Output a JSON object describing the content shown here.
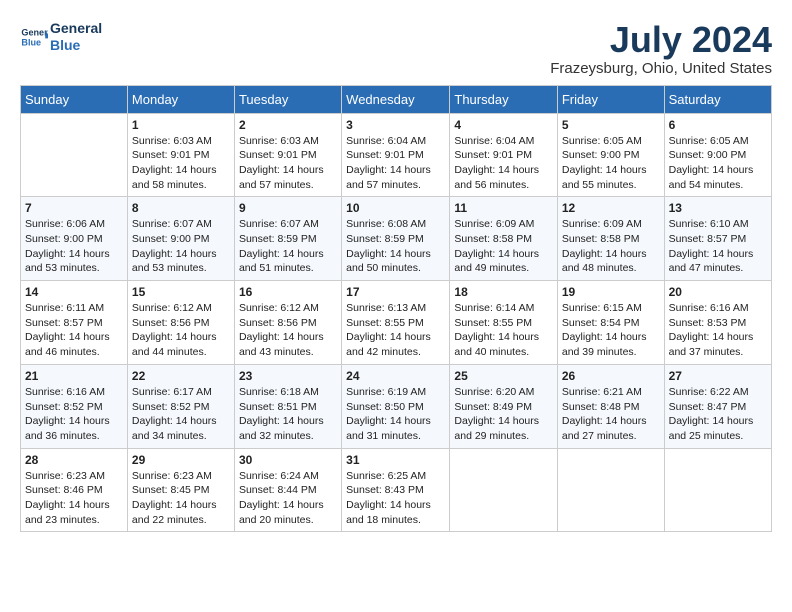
{
  "header": {
    "logo_line1": "General",
    "logo_line2": "Blue",
    "month_year": "July 2024",
    "location": "Frazeysburg, Ohio, United States"
  },
  "days_of_week": [
    "Sunday",
    "Monday",
    "Tuesday",
    "Wednesday",
    "Thursday",
    "Friday",
    "Saturday"
  ],
  "weeks": [
    [
      {
        "day": "",
        "sunrise": "",
        "sunset": "",
        "daylight": ""
      },
      {
        "day": "1",
        "sunrise": "Sunrise: 6:03 AM",
        "sunset": "Sunset: 9:01 PM",
        "daylight": "Daylight: 14 hours and 58 minutes."
      },
      {
        "day": "2",
        "sunrise": "Sunrise: 6:03 AM",
        "sunset": "Sunset: 9:01 PM",
        "daylight": "Daylight: 14 hours and 57 minutes."
      },
      {
        "day": "3",
        "sunrise": "Sunrise: 6:04 AM",
        "sunset": "Sunset: 9:01 PM",
        "daylight": "Daylight: 14 hours and 57 minutes."
      },
      {
        "day": "4",
        "sunrise": "Sunrise: 6:04 AM",
        "sunset": "Sunset: 9:01 PM",
        "daylight": "Daylight: 14 hours and 56 minutes."
      },
      {
        "day": "5",
        "sunrise": "Sunrise: 6:05 AM",
        "sunset": "Sunset: 9:00 PM",
        "daylight": "Daylight: 14 hours and 55 minutes."
      },
      {
        "day": "6",
        "sunrise": "Sunrise: 6:05 AM",
        "sunset": "Sunset: 9:00 PM",
        "daylight": "Daylight: 14 hours and 54 minutes."
      }
    ],
    [
      {
        "day": "7",
        "sunrise": "Sunrise: 6:06 AM",
        "sunset": "Sunset: 9:00 PM",
        "daylight": "Daylight: 14 hours and 53 minutes."
      },
      {
        "day": "8",
        "sunrise": "Sunrise: 6:07 AM",
        "sunset": "Sunset: 9:00 PM",
        "daylight": "Daylight: 14 hours and 53 minutes."
      },
      {
        "day": "9",
        "sunrise": "Sunrise: 6:07 AM",
        "sunset": "Sunset: 8:59 PM",
        "daylight": "Daylight: 14 hours and 51 minutes."
      },
      {
        "day": "10",
        "sunrise": "Sunrise: 6:08 AM",
        "sunset": "Sunset: 8:59 PM",
        "daylight": "Daylight: 14 hours and 50 minutes."
      },
      {
        "day": "11",
        "sunrise": "Sunrise: 6:09 AM",
        "sunset": "Sunset: 8:58 PM",
        "daylight": "Daylight: 14 hours and 49 minutes."
      },
      {
        "day": "12",
        "sunrise": "Sunrise: 6:09 AM",
        "sunset": "Sunset: 8:58 PM",
        "daylight": "Daylight: 14 hours and 48 minutes."
      },
      {
        "day": "13",
        "sunrise": "Sunrise: 6:10 AM",
        "sunset": "Sunset: 8:57 PM",
        "daylight": "Daylight: 14 hours and 47 minutes."
      }
    ],
    [
      {
        "day": "14",
        "sunrise": "Sunrise: 6:11 AM",
        "sunset": "Sunset: 8:57 PM",
        "daylight": "Daylight: 14 hours and 46 minutes."
      },
      {
        "day": "15",
        "sunrise": "Sunrise: 6:12 AM",
        "sunset": "Sunset: 8:56 PM",
        "daylight": "Daylight: 14 hours and 44 minutes."
      },
      {
        "day": "16",
        "sunrise": "Sunrise: 6:12 AM",
        "sunset": "Sunset: 8:56 PM",
        "daylight": "Daylight: 14 hours and 43 minutes."
      },
      {
        "day": "17",
        "sunrise": "Sunrise: 6:13 AM",
        "sunset": "Sunset: 8:55 PM",
        "daylight": "Daylight: 14 hours and 42 minutes."
      },
      {
        "day": "18",
        "sunrise": "Sunrise: 6:14 AM",
        "sunset": "Sunset: 8:55 PM",
        "daylight": "Daylight: 14 hours and 40 minutes."
      },
      {
        "day": "19",
        "sunrise": "Sunrise: 6:15 AM",
        "sunset": "Sunset: 8:54 PM",
        "daylight": "Daylight: 14 hours and 39 minutes."
      },
      {
        "day": "20",
        "sunrise": "Sunrise: 6:16 AM",
        "sunset": "Sunset: 8:53 PM",
        "daylight": "Daylight: 14 hours and 37 minutes."
      }
    ],
    [
      {
        "day": "21",
        "sunrise": "Sunrise: 6:16 AM",
        "sunset": "Sunset: 8:52 PM",
        "daylight": "Daylight: 14 hours and 36 minutes."
      },
      {
        "day": "22",
        "sunrise": "Sunrise: 6:17 AM",
        "sunset": "Sunset: 8:52 PM",
        "daylight": "Daylight: 14 hours and 34 minutes."
      },
      {
        "day": "23",
        "sunrise": "Sunrise: 6:18 AM",
        "sunset": "Sunset: 8:51 PM",
        "daylight": "Daylight: 14 hours and 32 minutes."
      },
      {
        "day": "24",
        "sunrise": "Sunrise: 6:19 AM",
        "sunset": "Sunset: 8:50 PM",
        "daylight": "Daylight: 14 hours and 31 minutes."
      },
      {
        "day": "25",
        "sunrise": "Sunrise: 6:20 AM",
        "sunset": "Sunset: 8:49 PM",
        "daylight": "Daylight: 14 hours and 29 minutes."
      },
      {
        "day": "26",
        "sunrise": "Sunrise: 6:21 AM",
        "sunset": "Sunset: 8:48 PM",
        "daylight": "Daylight: 14 hours and 27 minutes."
      },
      {
        "day": "27",
        "sunrise": "Sunrise: 6:22 AM",
        "sunset": "Sunset: 8:47 PM",
        "daylight": "Daylight: 14 hours and 25 minutes."
      }
    ],
    [
      {
        "day": "28",
        "sunrise": "Sunrise: 6:23 AM",
        "sunset": "Sunset: 8:46 PM",
        "daylight": "Daylight: 14 hours and 23 minutes."
      },
      {
        "day": "29",
        "sunrise": "Sunrise: 6:23 AM",
        "sunset": "Sunset: 8:45 PM",
        "daylight": "Daylight: 14 hours and 22 minutes."
      },
      {
        "day": "30",
        "sunrise": "Sunrise: 6:24 AM",
        "sunset": "Sunset: 8:44 PM",
        "daylight": "Daylight: 14 hours and 20 minutes."
      },
      {
        "day": "31",
        "sunrise": "Sunrise: 6:25 AM",
        "sunset": "Sunset: 8:43 PM",
        "daylight": "Daylight: 14 hours and 18 minutes."
      },
      {
        "day": "",
        "sunrise": "",
        "sunset": "",
        "daylight": ""
      },
      {
        "day": "",
        "sunrise": "",
        "sunset": "",
        "daylight": ""
      },
      {
        "day": "",
        "sunrise": "",
        "sunset": "",
        "daylight": ""
      }
    ]
  ]
}
